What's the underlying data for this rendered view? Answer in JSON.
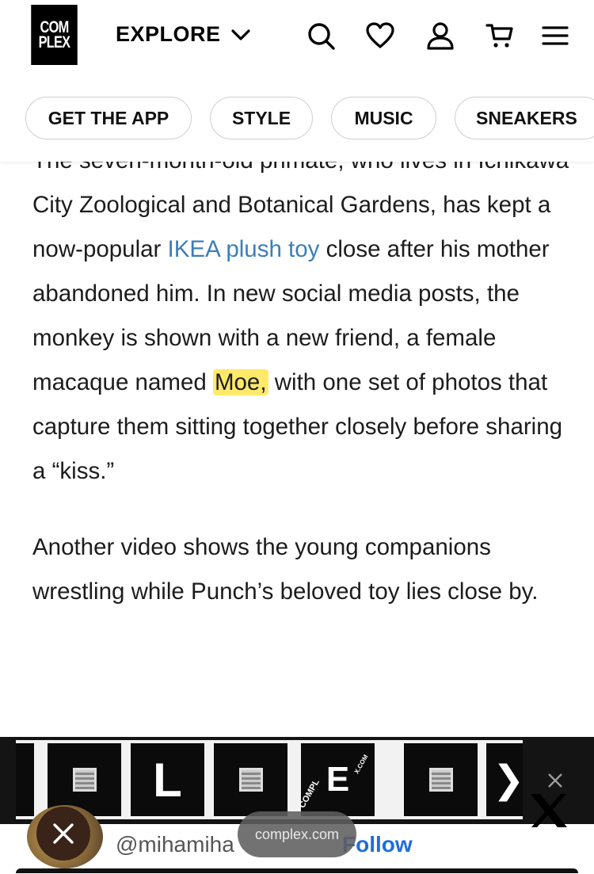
{
  "header": {
    "logo_top": "COM",
    "logo_bottom": "PLEX",
    "explore_label": "EXPLORE"
  },
  "icons": [
    "search-icon",
    "heart-icon",
    "user-icon",
    "cart-icon",
    "menu-icon",
    "chevron-down-icon"
  ],
  "nav_pills": [
    {
      "label": "GET THE APP"
    },
    {
      "label": "STYLE"
    },
    {
      "label": "MUSIC"
    },
    {
      "label": "SNEAKERS"
    }
  ],
  "article": {
    "p1_cut_line": "The seven-month-old primate, who lives in",
    "p1_text_a": "Ichikawa City Zoological and Botanical Gardens, has kept a now-popular ",
    "p1_link": "IKEA plush toy",
    "p1_text_b": " close after his mother abandoned him. In new social media posts, the monkey is shown with a new friend, a female macaque named ",
    "p1_highlight": "Moe,",
    "p1_text_c": " with one set of photos that capture them sitting together closely before sharing a “kiss.”",
    "p2": "Another video shows the young companions wrestling while Punch’s beloved toy lies close by."
  },
  "ad": {
    "tile_letters": [
      "L",
      "E"
    ],
    "tile_small_text": "COMPL",
    "tile_small_text_2": "X.COM",
    "arrow": "❯",
    "brand_mark": "X"
  },
  "embed": {
    "handle": "@mihamiha",
    "follow": "Follow",
    "domain": "complex.com"
  },
  "colors": {
    "link": "#3a7fb8",
    "highlight": "#ffe96b",
    "follow": "#1d6fd8"
  }
}
